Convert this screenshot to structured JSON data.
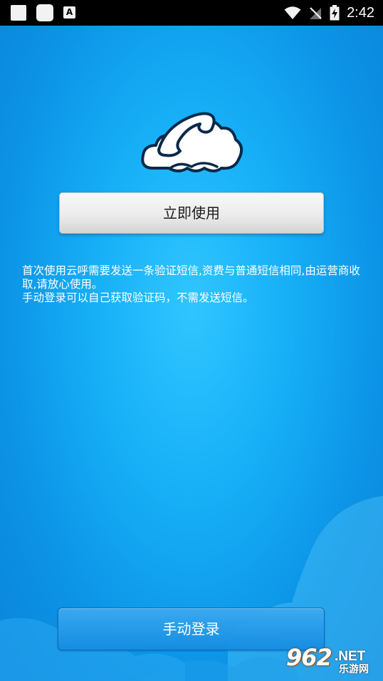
{
  "status_bar": {
    "notification_icons": [
      "square-icon",
      "rounded-square-icon",
      "a-icon"
    ],
    "a_icon_text": "A",
    "time": "2:42",
    "right_icons": [
      "wifi-icon",
      "no-signal-icon",
      "battery-charging-icon"
    ]
  },
  "main": {
    "logo_icon": "cloud-phone-icon",
    "primary_button_label": "立即使用",
    "description_lines": [
      "首次使用云呼需要发送一条验证短信,资费与普通短信相同,由运营商收取,请放心使用。",
      "手动登录可以自己获取验证码，不需发送短信。"
    ],
    "secondary_button_label": "手动登录"
  },
  "watermark": {
    "number": "962",
    "domain": ".NET",
    "site_name": "乐游网"
  },
  "colors": {
    "background": "#17b0f7",
    "status_bar": "#000000",
    "primary_button": "#ececec",
    "secondary_button": "#1f9be8"
  }
}
